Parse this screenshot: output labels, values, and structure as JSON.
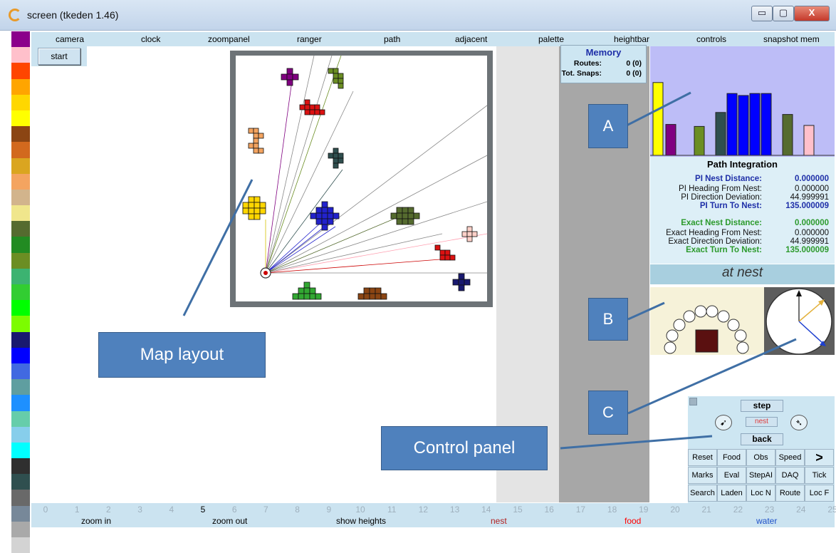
{
  "window": {
    "title": "screen (tkeden 1.46)",
    "minimize": "▭",
    "maximize": "▢",
    "close": "X"
  },
  "palette": [
    "#8b008b",
    "#ffc0cb",
    "#ff4500",
    "#ffa500",
    "#ffd700",
    "#ffff00",
    "#8b4513",
    "#d2691e",
    "#daa520",
    "#f4a460",
    "#d2b48c",
    "#f0e68c",
    "#556b2f",
    "#228b22",
    "#6b8e23",
    "#3cb371",
    "#32cd32",
    "#00ff00",
    "#7cfc00",
    "#191970",
    "#0000ff",
    "#4169e1",
    "#5f9ea0",
    "#1e90ff",
    "#66cdaa",
    "#87ceeb",
    "#00ffff",
    "#2f2f2f",
    "#2f4f4f",
    "#696969",
    "#778899",
    "#a9a9a9",
    "#d3d3d3"
  ],
  "menu": [
    "camera",
    "clock",
    "zoompanel",
    "ranger",
    "path",
    "adjacent",
    "palette",
    "heightbar",
    "controls",
    "snapshot mem"
  ],
  "start_label": "start",
  "memory": {
    "title": "Memory",
    "routes_label": "Routes:",
    "routes_value": "0 (0)",
    "snaps_label": "Tot. Snaps:",
    "snaps_value": "0 (0)"
  },
  "histogram": {
    "bars": [
      {
        "color": "#ffff00",
        "value": 0.73
      },
      {
        "color": "#800080",
        "value": 0.31
      },
      {
        "color": "#6b8e23",
        "value": 0.29
      },
      {
        "color": "#2f4f4f",
        "value": 0.43
      },
      {
        "color": "#0000ff",
        "value": 0.62
      },
      {
        "color": "#0000ff",
        "value": 0.6
      },
      {
        "color": "#0000ff",
        "value": 0.62
      },
      {
        "color": "#0000ff",
        "value": 0.62
      },
      {
        "color": "#556b2f",
        "value": 0.41
      },
      {
        "color": "#ffc0cb",
        "value": 0.3
      }
    ]
  },
  "path_integration": {
    "title": "Path Integration",
    "rows": [
      {
        "label": "PI Nest Distance:",
        "value": "0.000000",
        "style": "blue"
      },
      {
        "label": "PI Heading From Nest:",
        "value": "0.000000",
        "style": "plain"
      },
      {
        "label": "PI Direction Deviation:",
        "value": "44.999991",
        "style": "plain"
      },
      {
        "label": "PI Turn To Nest:",
        "value": "135.000009",
        "style": "blue"
      },
      {
        "label": "Exact Nest Distance:",
        "value": "0.000000",
        "style": "green"
      },
      {
        "label": "Exact Heading From Nest:",
        "value": "0.000000",
        "style": "plain"
      },
      {
        "label": "Exact Direction Deviation:",
        "value": "44.999991",
        "style": "plain"
      },
      {
        "label": "Exact Turn To Nest:",
        "value": "135.000009",
        "style": "green"
      }
    ],
    "status": "at nest"
  },
  "controls": {
    "step": "step",
    "nest": "nest",
    "back": "back",
    "left_icon": "rotate-left-icon",
    "right_icon": "rotate-right-icon",
    "grid": [
      [
        "Reset",
        "Food",
        "Obs",
        "Speed",
        ">"
      ],
      [
        "Marks",
        "Eval",
        "StepAI",
        "DAQ",
        "Tick"
      ],
      [
        "Search",
        "Laden",
        "Loc N",
        "Route",
        "Loc F"
      ]
    ]
  },
  "numbers": [
    "0",
    "1",
    "2",
    "3",
    "4",
    "5",
    "6",
    "7",
    "8",
    "9",
    "10",
    "11",
    "12",
    "13",
    "14",
    "15",
    "16",
    "17",
    "18",
    "19",
    "20",
    "21",
    "22",
    "23",
    "24",
    "25"
  ],
  "active_number": "5",
  "bottom": [
    {
      "label": "zoom in",
      "color": "#000000"
    },
    {
      "label": "zoom out",
      "color": "#000000"
    },
    {
      "label": "show heights",
      "color": "#000000"
    },
    {
      "label": "nest",
      "color": "#b22222"
    },
    {
      "label": "food",
      "color": "#ff0000"
    },
    {
      "label": "water",
      "color": "#1e50c8"
    }
  ],
  "annotations": {
    "a": "A",
    "b": "B",
    "c": "C",
    "map": "Map layout",
    "control": "Control panel"
  }
}
